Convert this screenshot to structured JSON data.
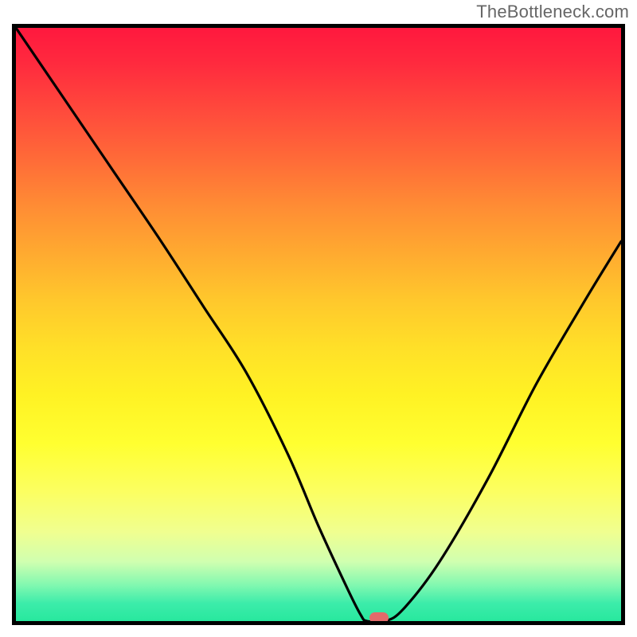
{
  "watermark": "TheBottleneck.com",
  "chart_data": {
    "type": "line",
    "title": "",
    "xlabel": "",
    "ylabel": "",
    "xlim": [
      0,
      100
    ],
    "ylim": [
      0,
      100
    ],
    "grid": false,
    "series": [
      {
        "name": "bottleneck-curve",
        "x": [
          0,
          8,
          16,
          24,
          31,
          38,
          45,
          50,
          55,
          57,
          58,
          61,
          64,
          70,
          78,
          86,
          94,
          100
        ],
        "values": [
          100,
          88,
          76,
          64,
          53,
          42,
          28,
          16,
          5,
          1,
          0,
          0,
          2,
          10,
          24,
          40,
          54,
          64
        ]
      }
    ],
    "marker": {
      "x": 60,
      "y": 0,
      "color": "#e46a6a"
    },
    "background_gradient": {
      "type": "vertical",
      "stops": [
        {
          "pos": 0,
          "color": "#ff183e"
        },
        {
          "pos": 50,
          "color": "#ffe028"
        },
        {
          "pos": 80,
          "color": "#fcff60"
        },
        {
          "pos": 100,
          "color": "#28e89e"
        }
      ]
    }
  },
  "colors": {
    "curve_stroke": "#000000",
    "border": "#000000",
    "marker": "#e46a6a",
    "watermark": "#666666"
  },
  "plot": {
    "inner_width": 760,
    "inner_height": 745
  }
}
